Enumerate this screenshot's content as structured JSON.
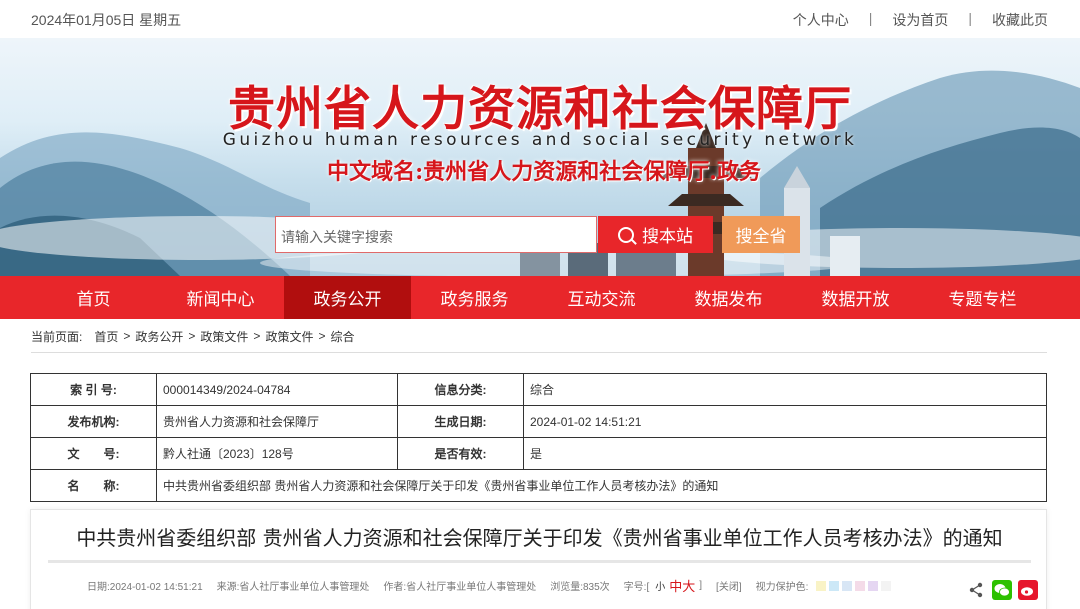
{
  "topbar": {
    "date": "2024年01月05日 星期五",
    "links": [
      "个人中心",
      "设为首页",
      "收藏此页"
    ],
    "separator": "|"
  },
  "banner": {
    "title": "贵州省人力资源和社会保障厅",
    "subtitle_en": "Guizhou human resources and social security network",
    "domain_name": "中文域名:贵州省人力资源和社会保障厅.政务",
    "search_placeholder": "请输入关键字搜索",
    "search_site_label": "搜本站",
    "search_province_label": "搜全省"
  },
  "nav": {
    "items": [
      "首页",
      "新闻中心",
      "政务公开",
      "政务服务",
      "互动交流",
      "数据发布",
      "数据开放",
      "专题专栏"
    ],
    "active_index": 2
  },
  "breadcrumb": {
    "label": "当前页面:",
    "items": [
      "首页",
      "政务公开",
      "政策文件",
      "政策文件",
      "综合"
    ],
    "separator": ">"
  },
  "meta": {
    "index_label": "索 引 号:",
    "index_value": "000014349/2024-04784",
    "category_label": "信息分类:",
    "category_value": "综合",
    "publisher_label": "发布机构:",
    "publisher_value": "贵州省人力资源和社会保障厅",
    "generated_label": "生成日期:",
    "generated_value": "2024-01-02 14:51:21",
    "docno_label": "文　　号:",
    "docno_value": "黔人社通〔2023〕128号",
    "valid_label": "是否有效:",
    "valid_value": "是",
    "name_label": "名　　称:",
    "name_value": "中共贵州省委组织部 贵州省人力资源和社会保障厅关于印发《贵州省事业单位工作人员考核办法》的通知"
  },
  "article": {
    "title": "中共贵州省委组织部 贵州省人力资源和社会保障厅关于印发《贵州省事业单位工作人员考核办法》的通知",
    "date": "日期:2024-01-02 14:51:21",
    "source": "来源:省人社厅事业单位人事管理处",
    "author": "作者:省人社厅事业单位人事管理处",
    "views": "浏览量:835次",
    "fontsize_label": "字号:[",
    "fs_small": "小",
    "fs_mid": "中",
    "fs_big": "大",
    "fontsize_end": "]",
    "close": "[关闭]",
    "vision_label": "视力保护色:",
    "swatches": [
      "#f9f3c6",
      "#cce8f7",
      "#d8e6f5",
      "#f4dbe8",
      "#e5d6f2",
      "#f3f3f3"
    ]
  },
  "colors": {
    "brand_red": "#e8262a",
    "nav_active": "#b10e0e",
    "search_orange": "#f09a59",
    "wechat": "#2dc100",
    "weibo": "#e6162d"
  }
}
